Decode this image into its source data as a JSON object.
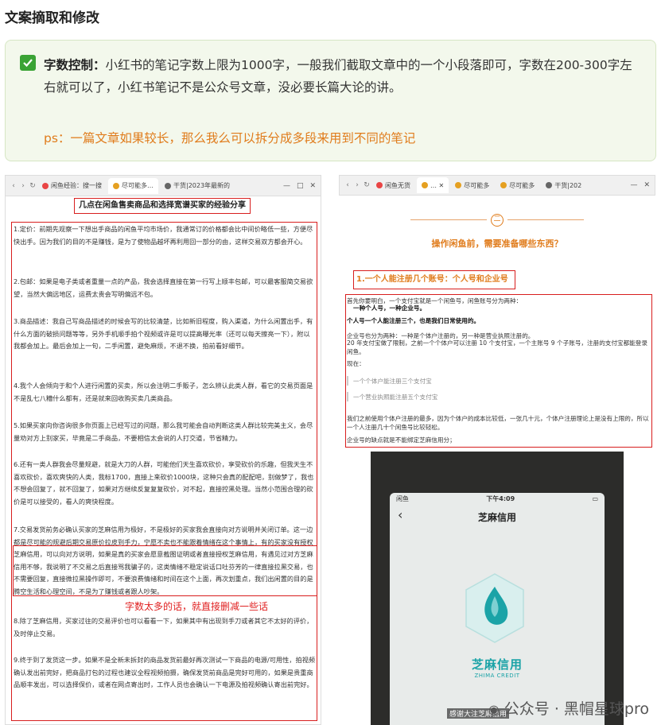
{
  "heading": "文案摘取和修改",
  "callout": {
    "label": "字数控制：",
    "text": "小红书的笔记字数上限为1000字，一般我们截取文章中的一个小段落即可，字数在200-300字左右就可以了，小红书笔记不是公众号文章，没必要长篇大论的讲。",
    "ps": "ps：一篇文章如果较长，那么我么可以拆分成多段来用到不同的笔记"
  },
  "left_shot": {
    "tabs": [
      "闲鱼经验：搜一搜",
      "尽可能多…",
      "干货|2023年最新的"
    ],
    "title": "几点在闲鱼售卖商品和选择宽谱买家的经验分享",
    "p1": "1.定价：前期先观察一下想出手商品的闲鱼平均市场价，我通常订的价格都会比中间价略低一些，方便尽快出手。因为我们的目的不是赚钱，是为了使物品越坏再利用回一部分的由，这样交易双方都会开心。",
    "p2": "2.包邮：如果是电子类或者重量一点的产品，我会选择直接在第一行写上顺丰包邮，可以最客服简交易欲望，当然大偏远地区，运费太贵会写明偏远不包。",
    "p3": "3.商品描述：我自己写商品描述的时候会写的比较清楚，比如新旧程度，购入渠道，为什么闲置出手，有什么方面的破损问题等等，另外手机顺手拍个视频或许是可以提高曝光率（还可以每天擦亮一下），附以我都会加上。最后会加上一句，二手闲置，避免麻烦，不退不换，拍前看好细节。",
    "p4": "4.我个人会倾向于和个人进行闲置的买卖，所以会注明二手贩子，怎么辨认此类人群，看它的交易页面是不是乱七八糟什么都有，还是就来回收购买卖几类商品。",
    "p5": "5.如果买家向你咨询很多你页面上已经写过的问题，那么我可能会自动判断这类人群比较完美主义，会尽量劝对方上别家买，毕竟是二手商品，不要相信太会说的人打交道，节省精力。",
    "p6": "6.还有一类人群我会尽量规避，就是大刀的人群，可能他们天生喜欢砍价，享受砍价的乐趣，但我天生不喜欢砍价，喜欢爽快的人类，我标1700，直接上来砍价1000块，这种只会真的配配吧，别做梦了，我也不想会回复了，就不回复了，如果对方继续反复复复砍价，对不起，直接控黑处理。当然小范围合理的砍价是可以接受的，看人的爽快程度。",
    "p7": "7.交易发货前务必确认买家的芝麻信用为极好，不是极好的买家我会直接向对方说明并关闭订单。这一边都是尽可能的规避后期交易原价拉皮到手力，宁愿不卖也不能跟着情绪在这个事情上，有的买家没有授权芝麻信用，可以向对方说明，如果是真的买家会愿意截图证明或者直接授权芝麻信用，有遇见过对方芝麻信用不够，我说明了不交易之后直接骂我骗子的，这类情绪不稳定说话口吐芬芳的一律直接拉黑交易，也不需要回复，直接微拉黑操作即可，不要浪费情绪和时间在这个上面，再次划重点，我们出闲置的目的是腾空生活和心理空间，不是为了赚钱或者跟人吵架。",
    "caption": "字数太多的话，就直接删减一些话",
    "p8": "8.除了芝麻信用，买家过往的交易评价也可以看看一下，如果其中有出现到手刀或者其它不太好的评价，及时停止交易。",
    "p9": "9.终于到了发货这一步。如果不是全新未拆封的商品发货前最好再次测试一下商品的电源/可用性，拍视频确认发出前完好，把商品打包的过程也建议全程视频拍摄，确保发货前商品是完好可用的，如果是贵重商品顺丰发出，可以选择保价，或者在网点寄出时，工作人员也会确认一下电源及拍视频确认寄出前完好。"
  },
  "right_shot": {
    "tabs": [
      "闲鱼无货",
      "尽可能多",
      "尽可能多",
      "干货|202"
    ],
    "circle_num": "二",
    "title": "操作闲鱼前，需要准备哪些东西？",
    "sub": "1.一个人能注册几个账号：个人号和企业号",
    "l1": "首先你要明白，一个支付宝就是一个闲鱼号，闲鱼账号分为两种：",
    "l2": "一种个人号，一种企业号。",
    "l3": "个人号一个人能注册三个，也是我们日常使用的。",
    "l4": "企业号也分为两种：一种是个体户注册的，另一种是营业执照注册的。",
    "l5": "20 年支付宝做了限制，之前一个个体户可以注册 10 个支付宝，一个主账号 9 个子账号，注册的支付宝都能登录闲鱼。",
    "l6": "现在：",
    "l7": "一个个体户能注册三个支付宝",
    "l8": "一个营业执照能注册五个支付宝",
    "l9": "我们之前使用个体户注册的最多，因为个体户的成本比较低，一张几十元，个体户注册理论上是没有上限的，所以一个人注册几十个闲鱼号比较轻松。",
    "l10": "企业号的缺点就是不能绑定芝麻信用分；",
    "phone": {
      "carrier": "闲鱼",
      "time": "下午4:09",
      "title": "芝麻信用",
      "brand_cn": "芝麻信用",
      "brand_en": "ZHIMA CREDIT",
      "caption": "感谢大注芝麻信用"
    },
    "watermark": "公众号 · 黑帽星球pro"
  },
  "colors": {
    "accent_green": "#3aa335",
    "highlight_green": "#3e8e21",
    "orange": "#e07c1c",
    "red": "#d81e1e",
    "teal": "#1ba3a7"
  }
}
